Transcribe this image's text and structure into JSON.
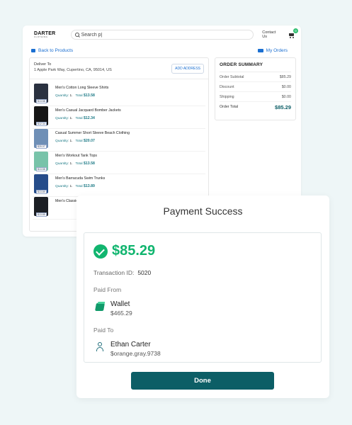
{
  "shop": {
    "logo_main": "DARTER",
    "logo_sub": "CLOTHING",
    "search_placeholder": "Search p|",
    "contact_label": "Contact Us",
    "cart_count": "0",
    "back_label": "Back to Products",
    "orders_label": "My Orders",
    "deliver_title": "Deliver To",
    "deliver_address": "1 Apple Park Way, Cupertino, CA, 95014, US",
    "add_address_label": "ADD ADDRESS",
    "quantity_label": "Quantity:",
    "total_label": "Total",
    "items": [
      {
        "name": "Men's Cotton Long Sleeve Shirts",
        "qty": "1",
        "total": "$13.58",
        "price": "$13.58",
        "color": "#2a3140"
      },
      {
        "name": "Men's Casual Jacquard Bomber Jackets",
        "qty": "1",
        "total": "$12.34",
        "price": "$12.34",
        "color": "#151515"
      },
      {
        "name": "Casual Summer Short Sleeve Beach Clothing",
        "qty": "1",
        "total": "$20.07",
        "price": "$20.07",
        "color": "#6f8fb6"
      },
      {
        "name": "Men's Workout Tank Tops",
        "qty": "1",
        "total": "$13.58",
        "price": "$13.58",
        "color": "#78c3a9"
      },
      {
        "name": "Men's Barracuda Swim Trunks",
        "qty": "1",
        "total": "$13.89",
        "price": "$13.89",
        "color": "#254c8a"
      },
      {
        "name": "Men's Classic",
        "qty": "",
        "total": "",
        "price": "$13.85",
        "color": "#1b1e24"
      }
    ],
    "summary": {
      "title": "ORDER SUMMARY",
      "rows": [
        {
          "label": "Order Subtotal",
          "value": "$85.29"
        },
        {
          "label": "Discount",
          "value": "$0.00"
        },
        {
          "label": "Shipping",
          "value": "$0.00"
        }
      ],
      "total_label": "Order Total",
      "total_value": "$85.29"
    }
  },
  "modal": {
    "title": "Payment Success",
    "amount": "$85.29",
    "transaction_label": "Transaction ID:",
    "transaction_id": "5020",
    "paid_from_label": "Paid From",
    "from_name": "Wallet",
    "from_balance": "$465.29",
    "paid_to_label": "Paid To",
    "to_name": "Ethan Carter",
    "to_handle": "$orange.gray.9738",
    "done_label": "Done"
  },
  "colors": {
    "accent": "#0c5e66",
    "success": "#11b56f",
    "link": "#1b6fd1"
  }
}
